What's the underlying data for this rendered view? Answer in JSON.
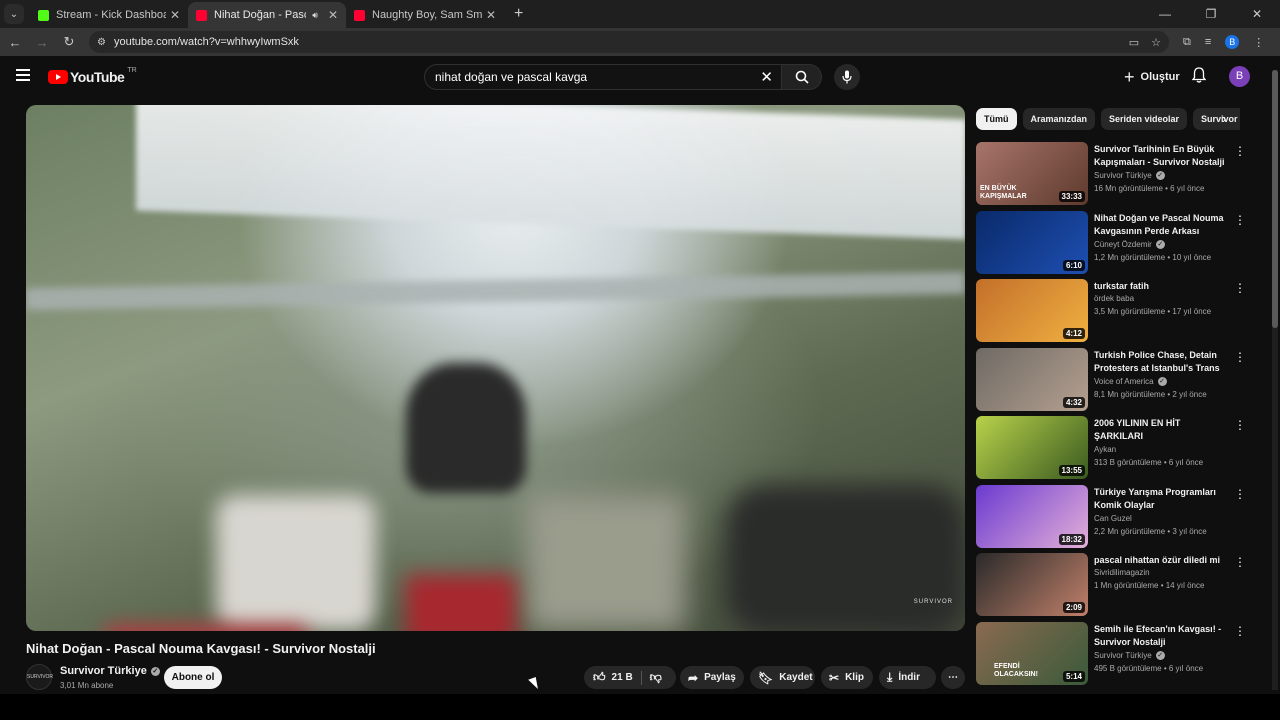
{
  "browser": {
    "tabs": [
      {
        "title": "Stream - Kick Dashboard",
        "favicon_color": "#53fc18",
        "active": false
      },
      {
        "title": "Nihat Doğan - Pascal Nouma",
        "favicon_color": "#ff0033",
        "active": true
      },
      {
        "title": "Naughty Boy, Sam Smith - La la",
        "favicon_color": "#ff0033",
        "active": false
      }
    ],
    "url": "youtube.com/watch?v=whhwyIwmSxk",
    "profile_initial": "B"
  },
  "yt": {
    "logo_text": "YouTube",
    "logo_region": "TR",
    "search_value": "nihat doğan ve pascal kavga",
    "create_label": "Oluştur",
    "user_initial": "B"
  },
  "video": {
    "title": "Nihat Doğan - Pascal Nouma Kavgası! - Survivor Nostalji",
    "channel": "Survivor Türkiye",
    "subscribers": "3,01 Mn abone",
    "subscribe_label": "Abone ol",
    "likes": "21 B",
    "share_label": "Paylaş",
    "save_label": "Kaydet",
    "clip_label": "Klip",
    "download_label": "İndir",
    "watermark": "SURVIVOR"
  },
  "chips": [
    "Tümü",
    "Aramanızdan",
    "Seriden videolar",
    "Survivor"
  ],
  "related": [
    {
      "title": "Survivor Tarihinin En Büyük Kapışmaları - Survivor Nostalji",
      "channel": "Survivor Türkiye",
      "verified": true,
      "meta": "16 Mn görüntüleme • 6 yıl önce",
      "duration": "33:33",
      "thumb_overlay": "EN BÜYÜK KAPIŞMALAR",
      "colors": [
        "#a8746a",
        "#5e3a2d"
      ]
    },
    {
      "title": "Nihat Doğan ve Pascal Nouma Kavgasının Perde Arkası",
      "channel": "Cüneyt Özdemir",
      "verified": true,
      "meta": "1,2 Mn görüntüleme • 10 yıl önce",
      "duration": "6:10",
      "thumb_overlay": "",
      "colors": [
        "#0a2a6a",
        "#1d4fb2"
      ]
    },
    {
      "title": "turkstar fatih",
      "channel": "ördek baba",
      "verified": false,
      "meta": "3,5 Mn görüntüleme • 17 yıl önce",
      "duration": "4:12",
      "thumb_overlay": "",
      "colors": [
        "#c3702b",
        "#f0b040"
      ]
    },
    {
      "title": "Turkish Police Chase, Detain Protesters at Istanbul's Trans ...",
      "channel": "Voice of America",
      "verified": true,
      "meta": "8,1 Mn görüntüleme • 2 yıl önce",
      "duration": "4:32",
      "thumb_overlay": "",
      "colors": [
        "#6e6a64",
        "#b5a090"
      ]
    },
    {
      "title": "2006 YILININ EN HİT ŞARKILARI",
      "channel": "Aykan",
      "verified": false,
      "meta": "313 B görüntüleme • 6 yıl önce",
      "duration": "13:55",
      "thumb_overlay": "",
      "colors": [
        "#b8d24a",
        "#3a5a20"
      ]
    },
    {
      "title": "Türkiye Yarışma Programları Komik Olaylar",
      "channel": "Can Guzel",
      "verified": false,
      "meta": "2,2 Mn görüntüleme • 3 yıl önce",
      "duration": "18:32",
      "thumb_overlay": "",
      "colors": [
        "#6a3ad0",
        "#e4b0d8"
      ]
    },
    {
      "title": "pascal nihattan özür diledi mi",
      "channel": "Sivridilimagazin",
      "verified": false,
      "meta": "1 Mn görüntüleme • 14 yıl önce",
      "duration": "2:09",
      "thumb_overlay": "",
      "colors": [
        "#2a2a2a",
        "#c0806a"
      ]
    },
    {
      "title": "Semih ile Efecan'ın Kavgası! - Survivor Nostalji",
      "channel": "Survivor Türkiye",
      "verified": true,
      "meta": "495 B görüntüleme • 6 yıl önce",
      "duration": "5:14",
      "thumb_overlay": "EFENDİ OLACAKSIN!",
      "colors": [
        "#8a6a50",
        "#3a5a3a"
      ]
    }
  ],
  "colors": {
    "accent_red": "#ff0000",
    "background": "#0f0f0f",
    "chip_bg": "#272727"
  }
}
